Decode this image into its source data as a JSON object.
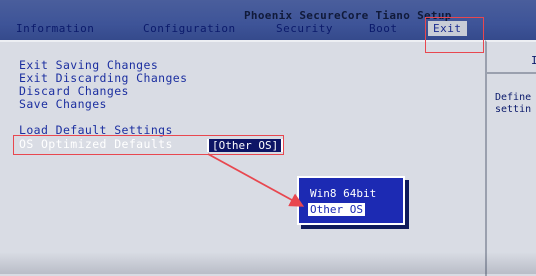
{
  "header": {
    "bios_title": "Phoenix SecureCore Tiano Setup",
    "tabs": [
      {
        "label": "Information"
      },
      {
        "label": "Configuration"
      },
      {
        "label": "Security"
      },
      {
        "label": "Boot"
      },
      {
        "label": "Exit"
      }
    ],
    "active_tab": "Exit"
  },
  "menu": {
    "items": [
      {
        "label": "Exit Saving Changes"
      },
      {
        "label": "Exit Discarding Changes"
      },
      {
        "label": "Discard Changes"
      },
      {
        "label": "Save Changes"
      },
      {
        "label": "Load Default Settings"
      },
      {
        "label": "OS Optimized Defaults",
        "value": "[Other OS]"
      }
    ]
  },
  "popup": {
    "options": [
      {
        "label": "Win8 64bit"
      },
      {
        "label": "Other OS"
      }
    ],
    "selected": "Other OS"
  },
  "help": {
    "header_visible": "I",
    "lines": [
      "Define",
      "settin"
    ]
  },
  "colors": {
    "header_bg": "#3e5498",
    "content_bg": "#d9dce4",
    "menu_text": "#1c2fa0",
    "popup_bg": "#1c2ab3",
    "annotation": "#e8474f"
  }
}
